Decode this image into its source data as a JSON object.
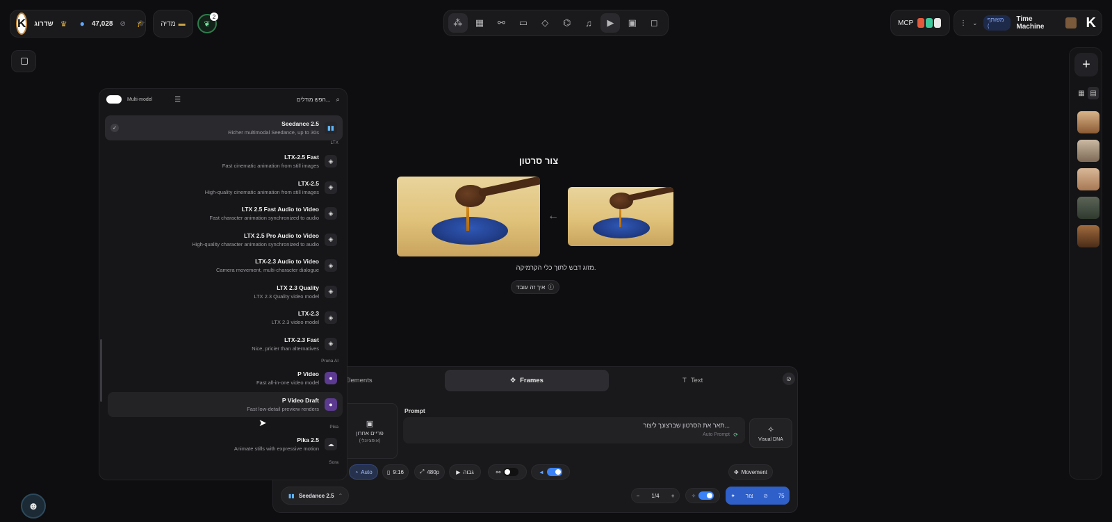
{
  "topbar": {
    "logo_letter": "K",
    "upgrade_label": "שדרוג",
    "credits": "47,028",
    "media_label": "מדיה",
    "notif_count": "2",
    "mcp_label": "MCP",
    "share_label": "משותף",
    "project_name": "Time Machine",
    "tools": [
      "nodes-icon",
      "grid-icon",
      "link-icon",
      "chat-icon",
      "cube-icon",
      "tree-icon",
      "music-icon",
      "video-icon",
      "image-icon",
      "comment-icon"
    ],
    "active_tool": "video-icon"
  },
  "model_panel": {
    "multi_model_label": "Multi-model",
    "search_placeholder": "חפש מודלים...",
    "selected": {
      "name": "Seedance 2.5",
      "desc": "Richer multimodal Seedance, up to 30s"
    },
    "groups": [
      {
        "label": "LTX",
        "models": [
          {
            "name": "LTX-2.5 Fast",
            "desc": "Fast cinematic animation from still images"
          },
          {
            "name": "LTX-2.5",
            "desc": "High-quality cinematic animation from still images"
          },
          {
            "name": "LTX 2.5 Fast Audio to Video",
            "desc": "Fast character animation synchronized to audio"
          },
          {
            "name": "LTX 2.5 Pro Audio to Video",
            "desc": "High-quality character animation synchronized to audio"
          },
          {
            "name": "LTX-2.3 Audio to Video",
            "desc": "Camera movement, multi-character dialogue"
          },
          {
            "name": "LTX 2.3 Quality",
            "desc": "LTX 2.3 Quality video model"
          },
          {
            "name": "LTX-2.3",
            "desc": "LTX 2.3 video model"
          },
          {
            "name": "LTX-2.3 Fast",
            "desc": "Nice, pricier than alternatives"
          }
        ]
      },
      {
        "label": "Pruna AI",
        "models": [
          {
            "name": "P Video",
            "desc": "Fast all-in-one video model"
          },
          {
            "name": "P Video Draft",
            "desc": "Fast low-detail preview renders"
          }
        ]
      },
      {
        "label": "Pika",
        "models": [
          {
            "name": "Pika 2.5",
            "desc": "Animate stills with expressive motion"
          }
        ]
      },
      {
        "label": "Sora",
        "models": []
      }
    ]
  },
  "center": {
    "title": "צור סרטון",
    "caption": "מזוג דבש לתוך כלי הקרמיקה.",
    "how_label": "איך זה עובד"
  },
  "composer": {
    "tabs": {
      "elements": "Elements",
      "frames": "Frames",
      "text": "Text"
    },
    "frame_label": "פריים אחרון",
    "frame_sub": "(אופציונלי)",
    "prompt_label": "Prompt",
    "prompt_placeholder": "תאר את הסרטון שברצונך ליצור...",
    "auto_prompt": "Auto Prompt",
    "visual_dna": "Visual DNA",
    "chips": {
      "auto": "Auto",
      "ratio": "9:16",
      "res": "480p",
      "quality": "גבוה",
      "movement": "Movement"
    },
    "model_name": "Seedance 2.5",
    "count": "1/4",
    "generate": "צור",
    "cost": "75"
  },
  "colors": {
    "accent": "#2f5fc8",
    "bg": "#0e0e10",
    "panel": "#161618"
  }
}
